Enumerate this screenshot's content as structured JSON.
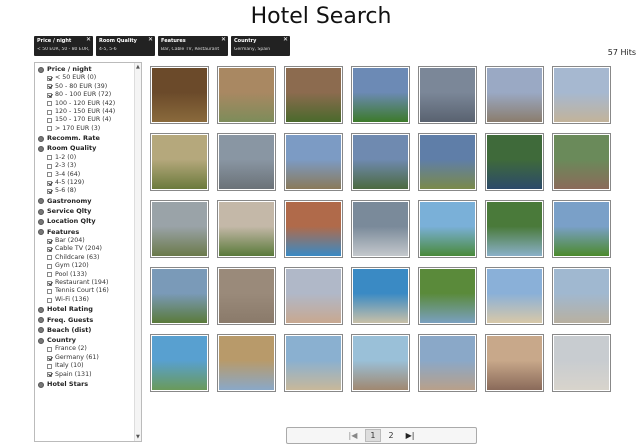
{
  "title": "Hotel Search",
  "hits": "57 Hits",
  "filters": [
    {
      "title": "Price / night",
      "value": "< 50 EUR, 50 - 80 EUR,..."
    },
    {
      "title": "Room Quality",
      "value": "4-5, 5-6"
    },
    {
      "title": "Features",
      "value": "Bar, Cable TV, Restaurant"
    },
    {
      "title": "Country",
      "value": "Germany, Spain"
    }
  ],
  "sidebar": {
    "price": {
      "label": "Price / night",
      "options": [
        {
          "label": "< 50 EUR (0)",
          "checked": true
        },
        {
          "label": "50 - 80 EUR (39)",
          "checked": true
        },
        {
          "label": "80 - 100 EUR (72)",
          "checked": true
        },
        {
          "label": "100 - 120 EUR (42)",
          "checked": false
        },
        {
          "label": "120 - 150 EUR (44)",
          "checked": false
        },
        {
          "label": "150 - 170 EUR (4)",
          "checked": false
        },
        {
          "label": "> 170 EUR (3)",
          "checked": false
        }
      ]
    },
    "recomm": "Recomm. Rate",
    "room": {
      "label": "Room Quality",
      "options": [
        {
          "label": "1-2 (0)",
          "checked": false
        },
        {
          "label": "2-3 (3)",
          "checked": false
        },
        {
          "label": "3-4 (64)",
          "checked": false
        },
        {
          "label": "4-5 (129)",
          "checked": true
        },
        {
          "label": "5-6 (8)",
          "checked": true
        }
      ]
    },
    "gastronomy": "Gastronomy",
    "service": "Service Qlty",
    "location": "Location Qlty",
    "features": {
      "label": "Features",
      "options": [
        {
          "label": "Bar (204)",
          "checked": true
        },
        {
          "label": "Cable TV (204)",
          "checked": true
        },
        {
          "label": "Childcare (63)",
          "checked": false
        },
        {
          "label": "Gym (120)",
          "checked": false
        },
        {
          "label": "Pool (133)",
          "checked": false
        },
        {
          "label": "Restaurant (194)",
          "checked": true
        },
        {
          "label": "Tennis Court (16)",
          "checked": false
        },
        {
          "label": "Wi-Fi (136)",
          "checked": false
        }
      ]
    },
    "rating": "Hotel Rating",
    "guests": "Freq. Guests",
    "beach": "Beach (dist)",
    "country": {
      "label": "Country",
      "options": [
        {
          "label": "France (2)",
          "checked": false
        },
        {
          "label": "Germany (61)",
          "checked": true
        },
        {
          "label": "Italy (10)",
          "checked": false
        },
        {
          "label": "Spain (131)",
          "checked": true
        }
      ]
    },
    "stars": "Hotel Stars"
  },
  "pager": {
    "first": "|◀",
    "p1": "1",
    "p2": "2",
    "last": "▶|"
  },
  "thumb_colors": [
    [
      "#6b4a2a",
      "#8a6a3c"
    ],
    [
      "#a98862",
      "#7d8c5a"
    ],
    [
      "#8c6b4f",
      "#4a6a2c"
    ],
    [
      "#6c8ab5",
      "#3c7a2a"
    ],
    [
      "#7b8798",
      "#596270"
    ],
    [
      "#9aa9c4",
      "#8b7d6d"
    ],
    [
      "#a6b8d0",
      "#c2b39a"
    ],
    [
      "#b5a87c",
      "#6b7a3c"
    ],
    [
      "#8996a3",
      "#6b7278"
    ],
    [
      "#7c9bc4",
      "#8a7a5a"
    ],
    [
      "#6f8ab0",
      "#4c6a40"
    ],
    [
      "#5f7ea8",
      "#7a8a4a"
    ],
    [
      "#3f6a3a",
      "#2c4a6a"
    ],
    [
      "#6a8a5a",
      "#8b6b5a"
    ],
    [
      "#9aa3a8",
      "#6b7a4a"
    ],
    [
      "#c4b8a8",
      "#5a7a3a"
    ],
    [
      "#b06a4a",
      "#3a8ac4"
    ],
    [
      "#7a8a9a",
      "#c4c8cc"
    ],
    [
      "#7ab0d8",
      "#4a8a3a"
    ],
    [
      "#4a7a3a",
      "#8ab0c8"
    ],
    [
      "#7aa0c8",
      "#4c8a2c"
    ],
    [
      "#7a9ab8",
      "#5a7a3a"
    ],
    [
      "#9a8a7a",
      "#8a7a6a"
    ],
    [
      "#b0b8c8",
      "#c8a890"
    ],
    [
      "#3a8ac4",
      "#c8c0a8"
    ],
    [
      "#5a8a3a",
      "#7aa0c0"
    ],
    [
      "#8ab0d8",
      "#d8c8a8"
    ],
    [
      "#a0b8d0",
      "#b8b0a0"
    ],
    [
      "#58a0d0",
      "#6a9a5a"
    ],
    [
      "#b89a6a",
      "#8aa8c8"
    ],
    [
      "#8ab0d0",
      "#c8b89a"
    ],
    [
      "#9ac0d8",
      "#a08870"
    ],
    [
      "#8aa8c8",
      "#b8a08a"
    ],
    [
      "#c8a88a",
      "#8a6a5a"
    ],
    [
      "#c8ccd0",
      "#d8d4cc"
    ]
  ]
}
